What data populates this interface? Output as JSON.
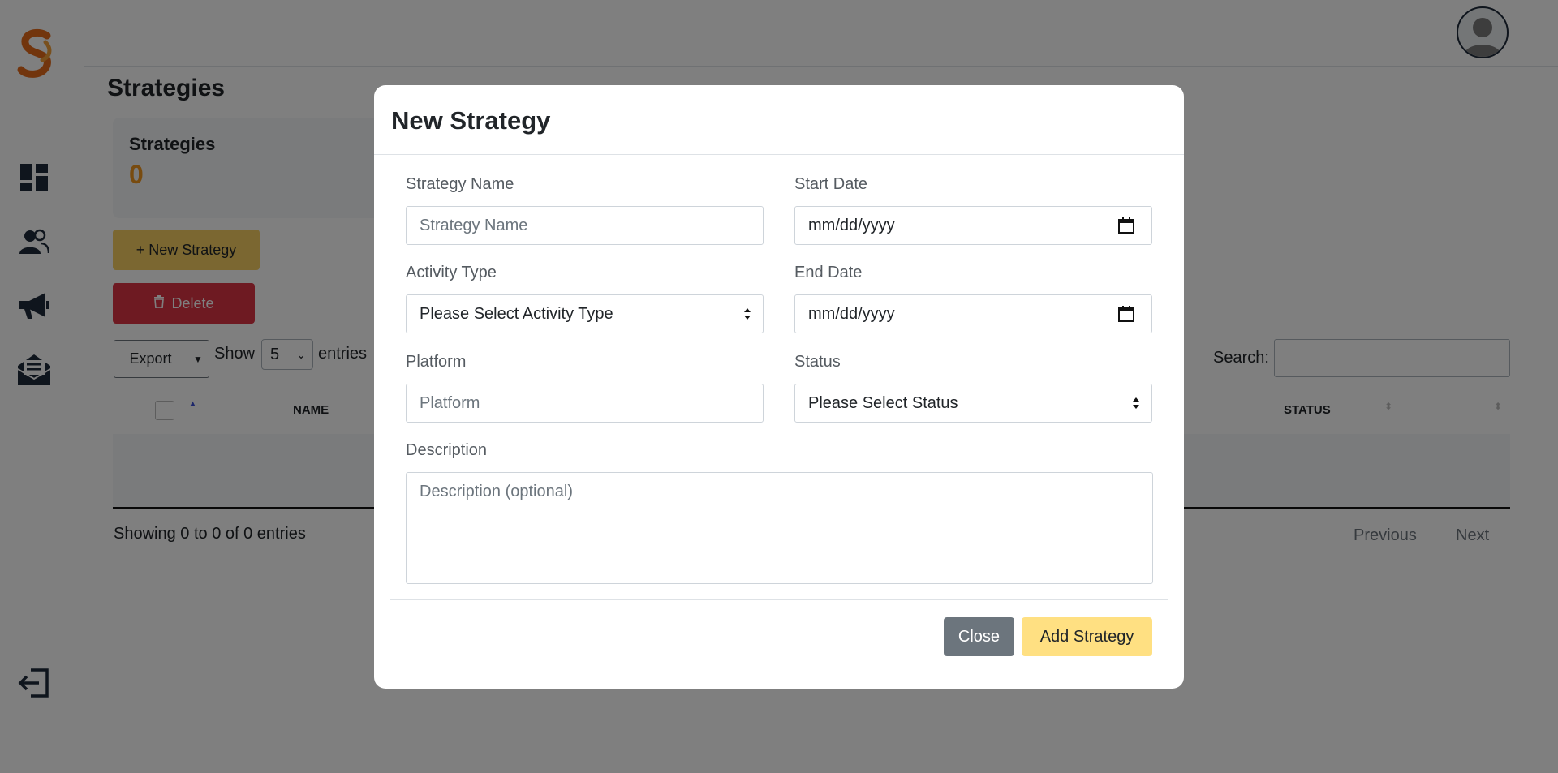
{
  "app": {
    "page_title": "Strategies",
    "stat": {
      "label": "Strategies",
      "value": "0"
    },
    "new_button": "+ New Strategy",
    "delete_button": "Delete",
    "export_button": "Export",
    "show_label": "Show",
    "entries_value": "5",
    "entries_label": "entries",
    "search_label": "Search:",
    "table": {
      "col_name": "NAME",
      "col_status": "STATUS"
    },
    "showing_text": "Showing 0 to 0 of 0 entries",
    "pagination": {
      "previous": "Previous",
      "next": "Next"
    }
  },
  "modal": {
    "title": "New Strategy",
    "strategy_name": {
      "label": "Strategy Name",
      "placeholder": "Strategy Name"
    },
    "start_date": {
      "label": "Start Date",
      "placeholder": "mm/dd/yyyy"
    },
    "activity_type": {
      "label": "Activity Type",
      "value": "Please Select Activity Type"
    },
    "end_date": {
      "label": "End Date",
      "placeholder": "mm/dd/yyyy"
    },
    "platform": {
      "label": "Platform",
      "placeholder": "Platform"
    },
    "status": {
      "label": "Status",
      "value": "Please Select Status"
    },
    "description": {
      "label": "Description",
      "placeholder": "Description (optional)"
    },
    "close_button": "Close",
    "add_button": "Add Strategy"
  },
  "colors": {
    "accent_yellow": "#f6cf63",
    "add_button_yellow": "#ffe082",
    "danger_red": "#dc3545",
    "stat_orange": "#f0961e",
    "nav_icon": "#1e2a3a",
    "close_gray": "#6c757d"
  },
  "icons": {
    "logo": "brand-logo",
    "nav": [
      "dashboard-icon",
      "users-icon",
      "megaphone-icon",
      "mail-icon"
    ],
    "logout": "logout-icon",
    "avatar": "user-avatar-icon"
  }
}
